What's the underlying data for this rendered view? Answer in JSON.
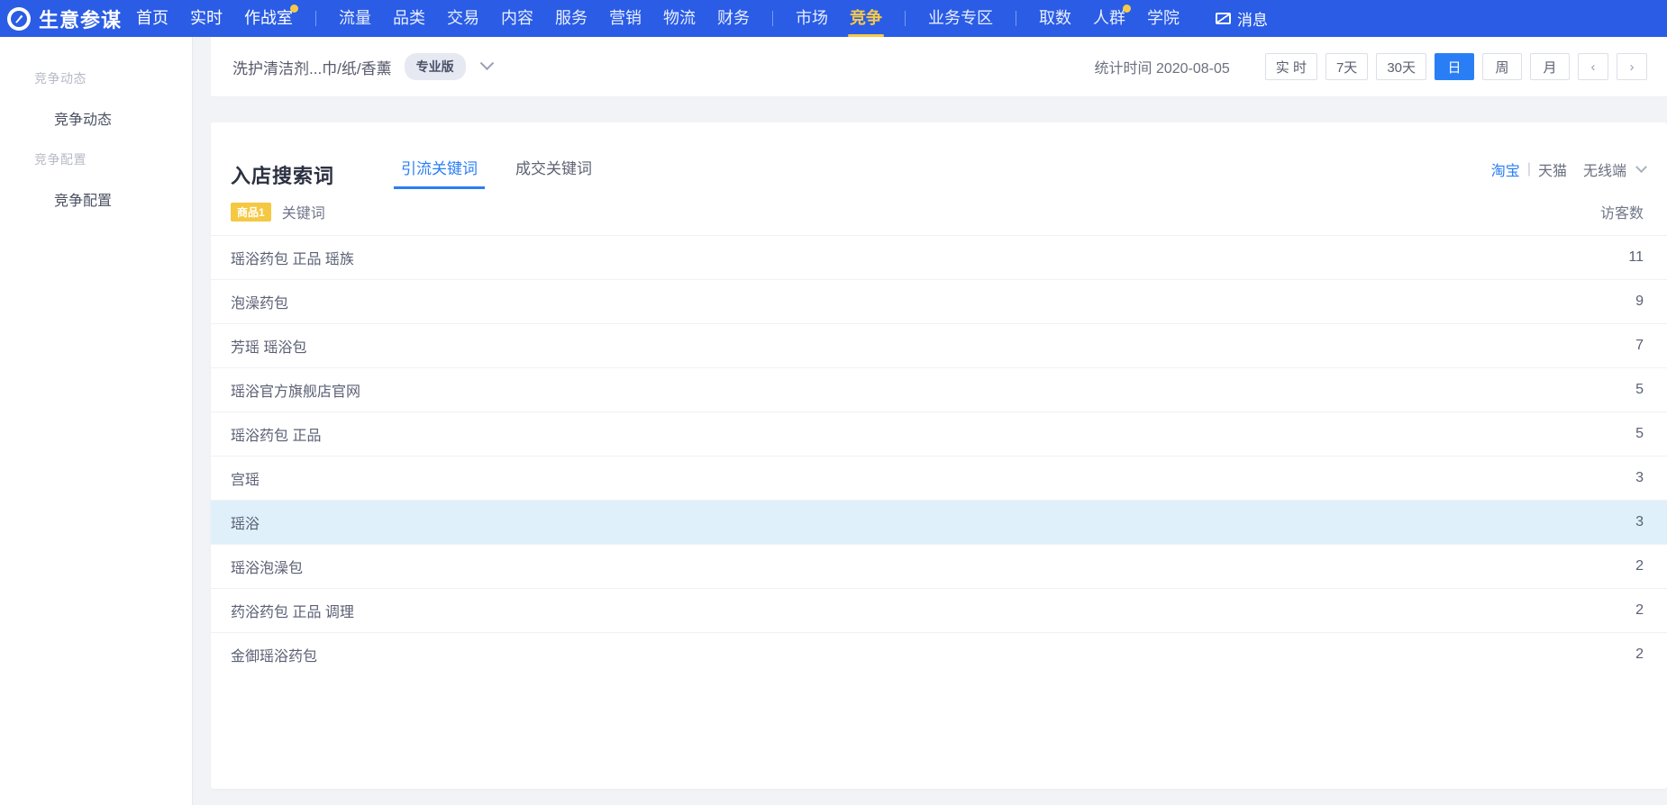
{
  "topnav": {
    "brand": "生意参谋",
    "logo_icon": "compass-pen-icon",
    "primary_items": [
      {
        "label": "首页",
        "dot": false
      },
      {
        "label": "实时",
        "dot": false
      },
      {
        "label": "作战室",
        "dot": true
      }
    ],
    "module_items": [
      {
        "label": "流量",
        "active": false
      },
      {
        "label": "品类",
        "active": false
      },
      {
        "label": "交易",
        "active": false
      },
      {
        "label": "内容",
        "active": false
      },
      {
        "label": "服务",
        "active": false
      },
      {
        "label": "营销",
        "active": false
      },
      {
        "label": "物流",
        "active": false
      },
      {
        "label": "财务",
        "active": false
      }
    ],
    "market_items": [
      {
        "label": "市场",
        "active": false
      },
      {
        "label": "竞争",
        "active": true
      }
    ],
    "zone_items": [
      {
        "label": "业务专区",
        "active": false
      }
    ],
    "tool_items": [
      {
        "label": "取数",
        "dot": false
      },
      {
        "label": "人群",
        "dot": true
      },
      {
        "label": "学院",
        "dot": false
      }
    ],
    "message_label": "消息",
    "message_icon": "envelope-icon",
    "accent_color": "#f7c948",
    "bar_color": "#2a5ce5"
  },
  "sidebar": {
    "groups": [
      {
        "title": "竞争动态",
        "items": [
          {
            "label": "竞争动态"
          }
        ]
      },
      {
        "title": "竞争配置",
        "items": [
          {
            "label": "竞争配置"
          }
        ]
      }
    ]
  },
  "filterbar": {
    "category": "洗护清洁剂...巾/纸/香薰",
    "version_badge": "专业版",
    "dropdown_icon": "chevron-down-icon",
    "stat_time_label": "统计时间 2020-08-05",
    "range_buttons": [
      {
        "label": "实 时",
        "active": false
      },
      {
        "label": "7天",
        "active": false
      },
      {
        "label": "30天",
        "active": false
      }
    ],
    "granularity_buttons": [
      {
        "label": "日",
        "active": true
      },
      {
        "label": "周",
        "active": false
      },
      {
        "label": "月",
        "active": false
      }
    ],
    "prev_icon": "chevron-left-icon",
    "prev_label": "‹",
    "next_icon": "chevron-right-icon",
    "next_label": "›"
  },
  "card": {
    "title": "入店搜索词",
    "tabs": [
      {
        "label": "引流关键词",
        "active": true
      },
      {
        "label": "成交关键词",
        "active": false
      }
    ],
    "platform": {
      "taobao": "淘宝",
      "divider": "|",
      "tmall": "天猫",
      "terminal": "无线端",
      "terminal_icon": "chevron-down-icon"
    },
    "table": {
      "badge": "商品1",
      "col_keyword": "关键词",
      "col_visitors": "访客数",
      "rows": [
        {
          "keyword": "瑶浴药包 正品 瑶族",
          "visitors": "11",
          "highlight": false
        },
        {
          "keyword": "泡澡药包",
          "visitors": "9",
          "highlight": false
        },
        {
          "keyword": "芳瑶 瑶浴包",
          "visitors": "7",
          "highlight": false
        },
        {
          "keyword": "瑶浴官方旗舰店官网",
          "visitors": "5",
          "highlight": false
        },
        {
          "keyword": "瑶浴药包 正品",
          "visitors": "5",
          "highlight": false
        },
        {
          "keyword": "宫瑶",
          "visitors": "3",
          "highlight": false
        },
        {
          "keyword": "瑶浴",
          "visitors": "3",
          "highlight": true
        },
        {
          "keyword": "瑶浴泡澡包",
          "visitors": "2",
          "highlight": false
        },
        {
          "keyword": "药浴药包 正品 调理",
          "visitors": "2",
          "highlight": false
        },
        {
          "keyword": "金御瑶浴药包",
          "visitors": "2",
          "highlight": false
        }
      ]
    }
  }
}
